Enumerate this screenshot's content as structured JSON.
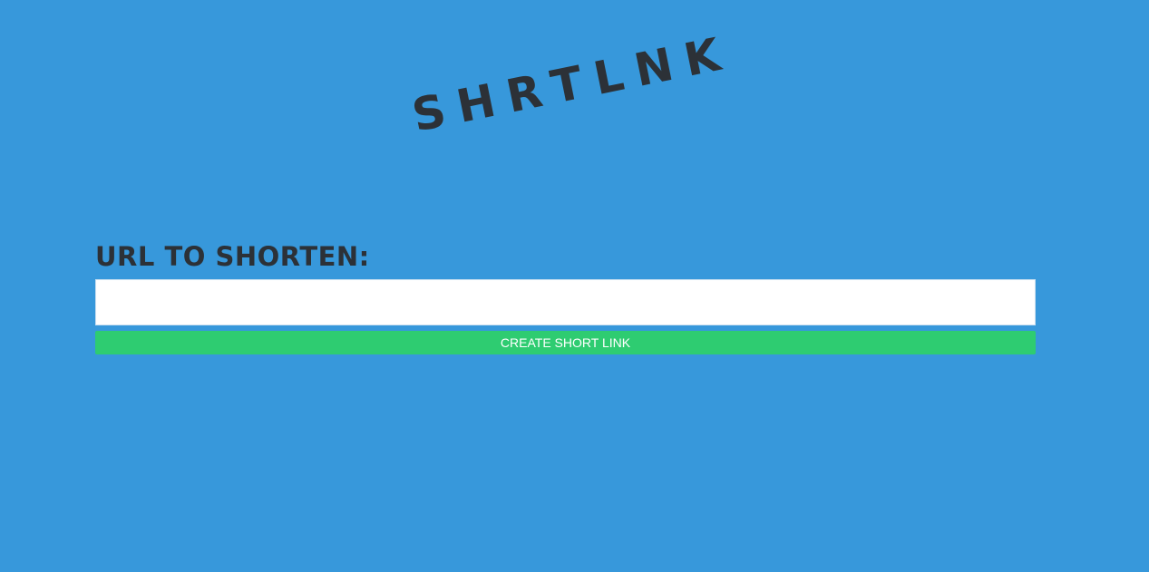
{
  "logo": {
    "text": "SHRTLNK"
  },
  "form": {
    "label": "URL TO SHORTEN:",
    "input_value": "",
    "input_placeholder": "",
    "submit_label": "CREATE SHORT LINK"
  },
  "colors": {
    "background": "#3798db",
    "text_dark": "#2c3137",
    "button": "#2ecc71",
    "button_text": "#ffffff",
    "input_bg": "#ffffff"
  }
}
